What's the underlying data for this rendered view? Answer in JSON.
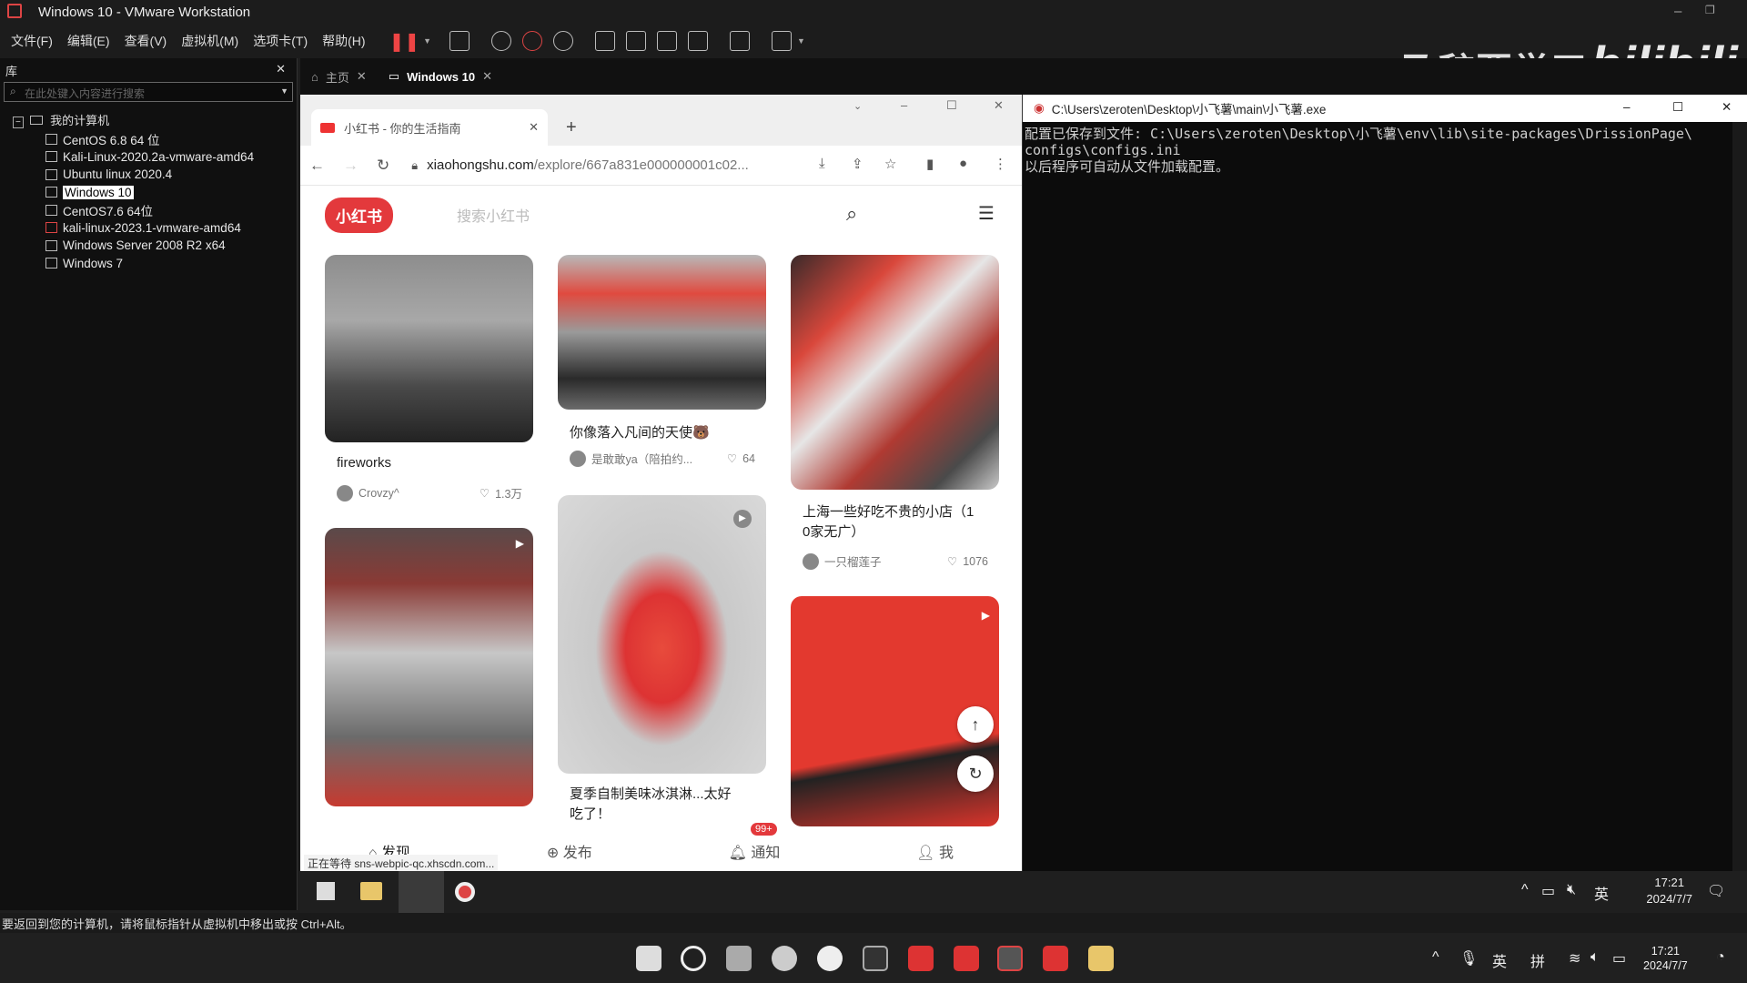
{
  "vm_window": {
    "title": "Windows 10 - VMware Workstation",
    "menu": [
      "文件(F)",
      "编辑(E)",
      "查看(V)",
      "虚拟机(M)",
      "选项卡(T)",
      "帮助(H)"
    ]
  },
  "library": {
    "header": "库",
    "search_placeholder": "在此处键入内容进行搜索",
    "root": "我的计算机",
    "vms": [
      "CentOS 6.8 64 位",
      "Kali-Linux-2020.2a-vmware-amd64",
      "Ubuntu linux 2020.4",
      "Windows 10",
      "CentOS7.6 64位",
      "kali-linux-2023.1-vmware-amd64",
      "Windows Server 2008 R2 x64",
      "Windows 7"
    ],
    "selected": "Windows 10"
  },
  "vm_tabs": [
    "主页",
    "Windows 10"
  ],
  "watermark": {
    "text": "及辞要学习",
    "logo": "bilibili"
  },
  "browser": {
    "tab_title": "小红书 - 你的生活指南",
    "url_main": "xiaohongshu.com",
    "url_rest": "/explore/667a831e000000001c02...",
    "status": "正在等待 sns-webpic-qc.xhscdn.com..."
  },
  "xhs": {
    "logo": "小红书",
    "search_placeholder": "搜索小红书",
    "notes": [
      {
        "title": "fireworks",
        "author": "Crovzy^",
        "likes": "1.3万"
      },
      {
        "title": "你像落入凡间的天使🐻",
        "author": "是敢敢ya（陪拍约...",
        "likes": "64"
      },
      {
        "title": "上海一些好吃不贵的小店（10家无广）",
        "title_line1": "上海一些好吃不贵的小店（1",
        "title_line2": "0家无广）",
        "author": "一只榴莲子",
        "likes": "1076"
      },
      {
        "title": "夏季自制美味冰淇淋...太好吃了！",
        "title_line1": "夏季自制美味冰淇淋...太好",
        "title_line2": "吃了！"
      }
    ],
    "bottom_nav": [
      "发现",
      "发布",
      "通知",
      "我"
    ],
    "badge": "99+"
  },
  "console": {
    "title": "C:\\Users\\zeroten\\Desktop\\小飞薯\\main\\小飞薯.exe",
    "lines": [
      "配置已保存到文件: C:\\Users\\zeroten\\Desktop\\小飞薯\\env\\lib\\site-packages\\DrissionPage\\",
      "configs\\configs.ini",
      "以后程序可自动从文件加载配置。"
    ]
  },
  "guest_taskbar": {
    "time": "17:21",
    "date": "2024/7/7",
    "ime": "英"
  },
  "host_status": "要返回到您的计算机，请将鼠标指针从虚拟机中移出或按 Ctrl+Alt。",
  "host_taskbar": {
    "time": "17:21",
    "date": "2024/7/7",
    "ime1": "英",
    "ime2": "拼"
  }
}
